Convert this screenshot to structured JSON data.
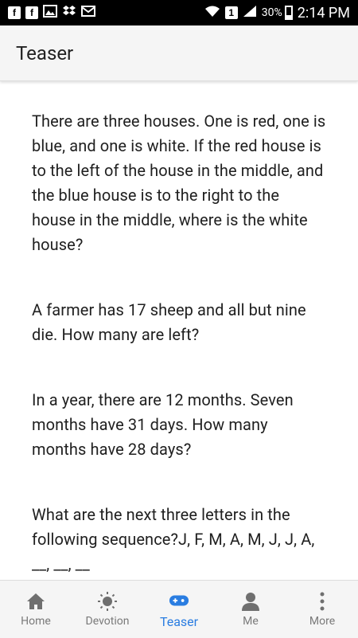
{
  "status_bar": {
    "time": "2:14 PM",
    "battery": "30%",
    "sim_slot": "1",
    "notification_icons": [
      "facebook-icon",
      "facebook-icon",
      "image-icon",
      "dropbox-icon",
      "mail-icon"
    ]
  },
  "app_bar": {
    "title": "Teaser"
  },
  "questions": [
    {
      "text": "There are three houses. One is red, one is blue, and one is white. If the red house is to the left of the house in the middle, and the blue house is to the right to the house in the middle, where is the white house?"
    },
    {
      "text": "A farmer has 17 sheep and all but nine die. How many are left?"
    },
    {
      "text": "In a year, there are 12 months. Seven months have 31 days. How many months have 28 days?"
    },
    {
      "text": "What are the next three letters in the following sequence?J, F, M, A, M, J, J, A, __, __, __"
    }
  ],
  "bottom_nav": {
    "items": [
      {
        "label": "Home",
        "icon": "home-icon"
      },
      {
        "label": "Devotion",
        "icon": "sun-icon"
      },
      {
        "label": "Teaser",
        "icon": "gamepad-icon",
        "active": true
      },
      {
        "label": "Me",
        "icon": "person-icon"
      },
      {
        "label": "More",
        "icon": "more-vert-icon"
      }
    ]
  },
  "colors": {
    "accent": "#2a7de1",
    "inactive": "#7a7a7a",
    "text": "#202020"
  }
}
